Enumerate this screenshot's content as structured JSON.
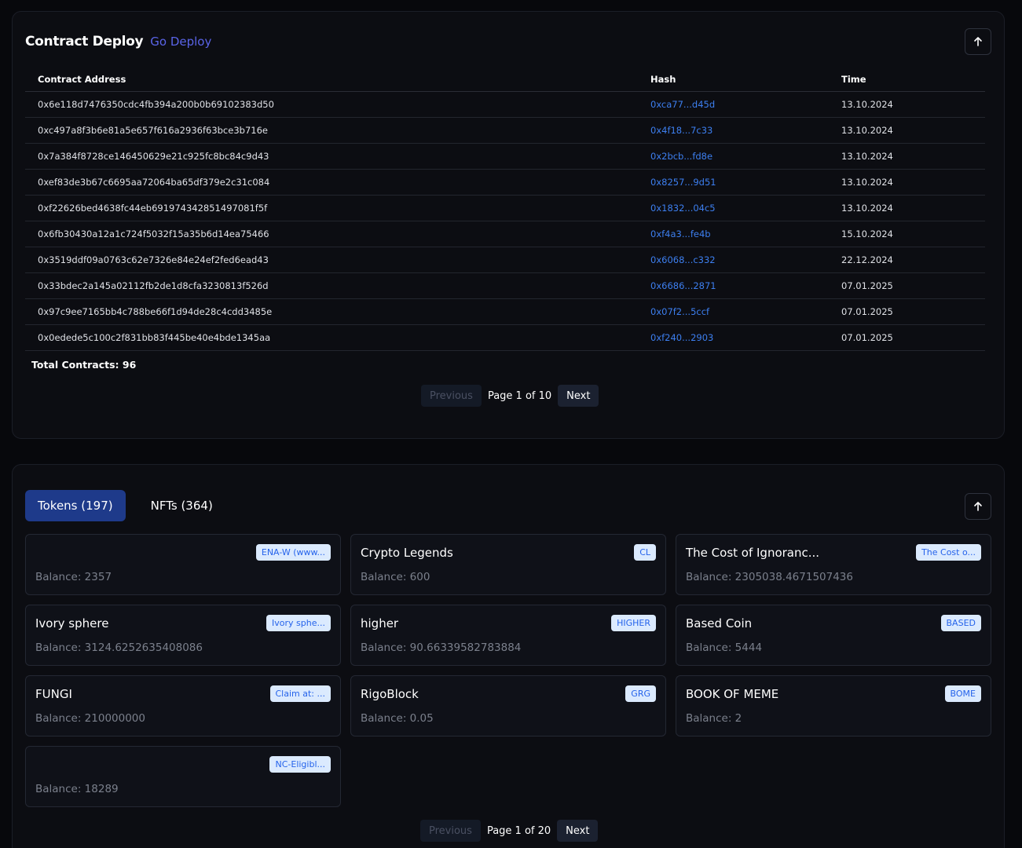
{
  "contract_deploy": {
    "title": "Contract Deploy",
    "link": "Go Deploy",
    "columns": [
      "Contract Address",
      "Hash",
      "Time"
    ],
    "rows": [
      {
        "address": "0x6e118d7476350cdc4fb394a200b0b69102383d50",
        "hash": "0xca77...d45d",
        "time": "13.10.2024"
      },
      {
        "address": "0xc497a8f3b6e81a5e657f616a2936f63bce3b716e",
        "hash": "0x4f18...7c33",
        "time": "13.10.2024"
      },
      {
        "address": "0x7a384f8728ce146450629e21c925fc8bc84c9d43",
        "hash": "0x2bcb...fd8e",
        "time": "13.10.2024"
      },
      {
        "address": "0xef83de3b67c6695aa72064ba65df379e2c31c084",
        "hash": "0x8257...9d51",
        "time": "13.10.2024"
      },
      {
        "address": "0xf22626bed4638fc44eb691974342851497081f5f",
        "hash": "0x1832...04c5",
        "time": "13.10.2024"
      },
      {
        "address": "0x6fb30430a12a1c724f5032f15a35b6d14ea75466",
        "hash": "0xf4a3...fe4b",
        "time": "15.10.2024"
      },
      {
        "address": "0x3519ddf09a0763c62e7326e84e24ef2fed6ead43",
        "hash": "0x6068...c332",
        "time": "22.12.2024"
      },
      {
        "address": "0x33bdec2a145a02112fb2de1d8cfa3230813f526d",
        "hash": "0x6686...2871",
        "time": "07.01.2025"
      },
      {
        "address": "0x97c9ee7165bb4c788be66f1d94de28c4cdd3485e",
        "hash": "0x07f2...5ccf",
        "time": "07.01.2025"
      },
      {
        "address": "0x0edede5c100c2f831bb83f445be40e4bde1345aa",
        "hash": "0xf240...2903",
        "time": "07.01.2025"
      }
    ],
    "total": "Total Contracts: 96",
    "pager": {
      "previous": "Previous",
      "page": "Page 1 of 10",
      "next": "Next"
    }
  },
  "assets": {
    "tabs": [
      {
        "label": "Tokens (197)",
        "active": true
      },
      {
        "label": "NFTs (364)",
        "active": false
      }
    ],
    "tokens": [
      {
        "name": "",
        "badge": "ENA-W (www...",
        "balance": "Balance: 2357"
      },
      {
        "name": "Crypto Legends",
        "badge": "CL",
        "balance": "Balance: 600"
      },
      {
        "name": "The Cost of Ignoranc...",
        "badge": "The Cost o...",
        "balance": "Balance: 2305038.4671507436"
      },
      {
        "name": "Ivory sphere",
        "badge": "Ivory sphe...",
        "balance": "Balance: 3124.6252635408086"
      },
      {
        "name": "higher",
        "badge": "HIGHER",
        "balance": "Balance: 90.66339582783884"
      },
      {
        "name": "Based Coin",
        "badge": "BASED",
        "balance": "Balance: 5444"
      },
      {
        "name": "FUNGI",
        "badge": "Claim at: ...",
        "balance": "Balance: 210000000"
      },
      {
        "name": "RigoBlock",
        "badge": "GRG",
        "balance": "Balance: 0.05"
      },
      {
        "name": "BOOK OF MEME",
        "badge": "BOME",
        "balance": "Balance: 2"
      },
      {
        "name": "",
        "badge": "NC-Eligibl...",
        "balance": "Balance: 18289"
      }
    ],
    "pager": {
      "previous": "Previous",
      "page": "Page 1 of 20",
      "next": "Next"
    }
  },
  "icons": {
    "scroll_top": "arrow-up-icon"
  },
  "colors": {
    "accent_link": "#5a64e8",
    "hash_link": "#3d7ff0",
    "active_tab": "#1e3a8a",
    "badge_bg": "#dbeafe",
    "badge_text": "#2563eb"
  }
}
